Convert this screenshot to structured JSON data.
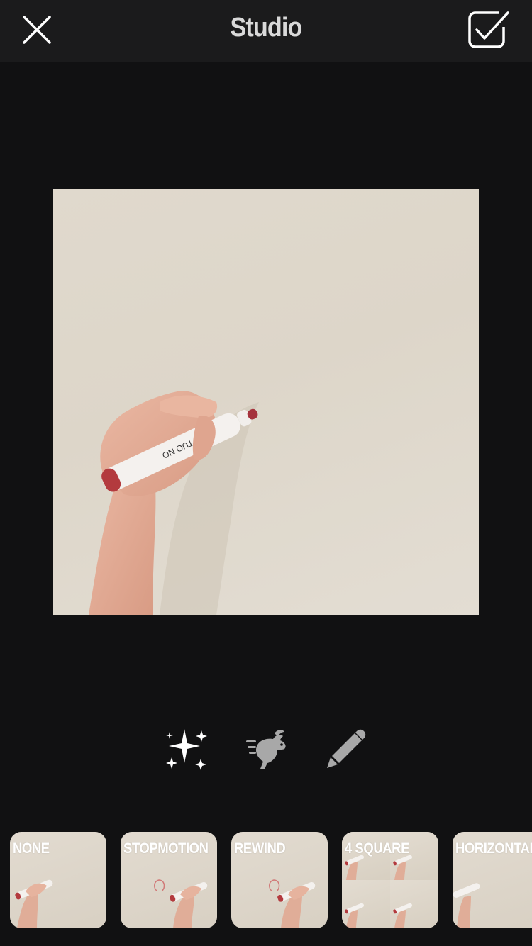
{
  "header": {
    "title": "Studio",
    "close_icon": "close-x-icon",
    "done_icon": "checkbox-check-icon"
  },
  "tools": [
    {
      "name": "effects",
      "icon": "sparkles-icon"
    },
    {
      "name": "speed",
      "icon": "running-rabbit-icon"
    },
    {
      "name": "draw",
      "icon": "pencil-icon"
    }
  ],
  "filters": [
    {
      "label": "NONE"
    },
    {
      "label": "STOPMOTION"
    },
    {
      "label": "REWIND"
    },
    {
      "label": "4 SQUARE"
    },
    {
      "label": "HORIZONTAL"
    }
  ],
  "colors": {
    "background": "#111112",
    "topbar": "#1b1b1c",
    "title": "#d9d9d9",
    "active_tool": "#ffffff",
    "inactive_tool": "#a8a8a8"
  }
}
